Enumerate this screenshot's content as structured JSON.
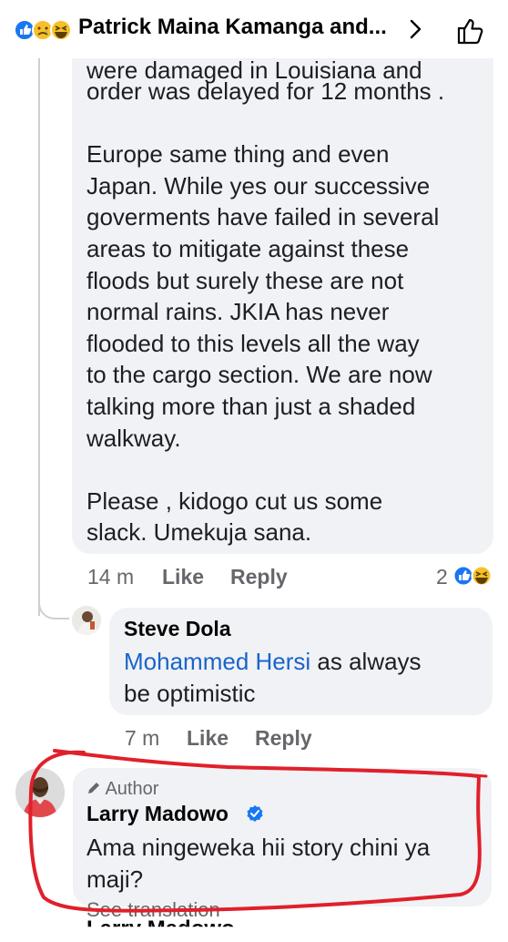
{
  "header": {
    "title": "Patrick Maina Kamanga and...",
    "reactions": [
      "like-icon",
      "sad-icon",
      "haha-icon"
    ]
  },
  "comment1": {
    "top_cut": "were damaged in Louisiana and",
    "text": "order was delayed for 12 months .\n\nEurope same thing and even\nJapan. While yes our successive\ngoverments have failed in several\nareas to mitigate against these\nfloods but surely these are not\nnormal rains. JKIA has never\nflooded to this levels all the way\nto the cargo section.  We are now\ntalking more than just a shaded\nwalkway.\n\nPlease , kidogo cut us some\nslack.  Umekuja sana.",
    "time": "14 m",
    "like": "Like",
    "reply": "Reply",
    "reaction_count": "2"
  },
  "reply1": {
    "author": "Steve Dola",
    "mention": "Mohammed Hersi",
    "text_after_mention": " as always",
    "line2": "be optimistic",
    "time": "7 m",
    "like": "Like",
    "reply": "Reply"
  },
  "reply2": {
    "badge": "Author",
    "author": "Larry Madowo",
    "line1": "Ama ningeweka hii story chini ya",
    "line2": "maji?",
    "see_translation": "See translation",
    "next_author_cut": "Larry Madowo"
  },
  "colors": {
    "bubble": "#f0f2f5",
    "link": "#1b64c8",
    "meta": "#65676b",
    "annotation": "#e0202a",
    "verified": "#1877f2"
  }
}
